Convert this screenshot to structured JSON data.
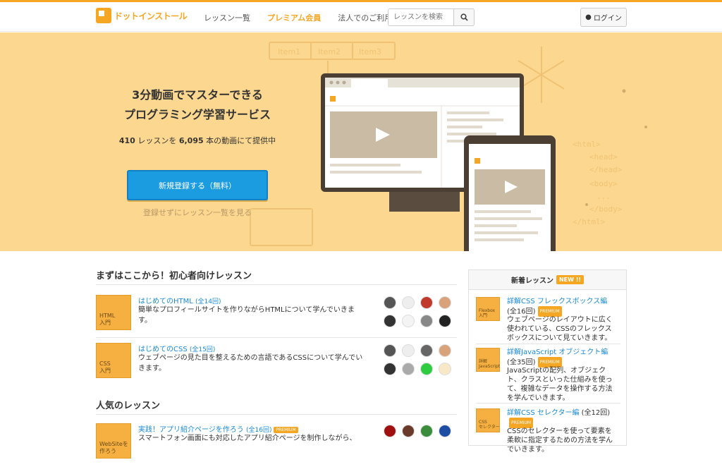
{
  "header": {
    "logo_text": "ドットインストール",
    "nav": [
      "レッスン一覧",
      "プレミアム会員",
      "法人でのご利用"
    ],
    "search_placeholder": "レッスンを検索",
    "login_label": "ログイン"
  },
  "hero": {
    "title_line1": "3分動画でマスターできる",
    "title_line2": "プログラミング学習サービス",
    "lessons_count": "410",
    "lessons_text1": " レッスンを ",
    "videos_count": "6,095",
    "lessons_text2": " 本の動画にて提供中",
    "cta_label": "新規登録する（無料）",
    "browse_link": "登録せずにレッスン一覧を見る",
    "art_tabs": [
      "Item1",
      "Item2",
      "Item3"
    ],
    "art_code": [
      "<html>",
      "<head>",
      "</head>",
      "<body>",
      "...",
      "</body>",
      "</html>"
    ]
  },
  "beginner": {
    "heading": "まずはここから！初心者向けレッスン",
    "lessons": [
      {
        "thumb": "HTML\n入門",
        "title": "はじめてのHTML",
        "count": "(全14回)",
        "desc": "簡単なプロフィールサイトを作りながらHTMLについて学んでいきます。"
      },
      {
        "thumb": "CSS\n入門",
        "title": "はじめてのCSS",
        "count": "(全15回)",
        "desc": "ウェブページの見た目を整えるための言語であるCSSについて学んでいきます。"
      }
    ]
  },
  "popular": {
    "heading": "人気のレッスン",
    "lessons": [
      {
        "thumb": "WebSiteを\n作ろう",
        "title": "実践！アプリ紹介ページを作ろう",
        "count": "(全16回)",
        "badge": "PREMIUM",
        "desc": "スマートフォン画面にも対応したアプリ紹介ページを制作しながら、"
      }
    ]
  },
  "sidebar": {
    "heading": "新着レッスン",
    "new_badge": "NEW !!",
    "items": [
      {
        "thumb": "Flexbox\n入門",
        "title": "詳解CSS フレックスボックス編",
        "count": "(全16回)",
        "badge": "PREMIUM",
        "desc": "ウェブページのレイアウトに広く使われている、CSSのフレックスボックスについて見ていきます。"
      },
      {
        "thumb": "詳解\nJavaScript",
        "title": "詳解JavaScript オブジェクト編",
        "count": "(全35回)",
        "badge": "PREMIUM",
        "desc": "JavaScriptの配列、オブジェクト、クラスといった仕組みを使って、複雑なデータを操作する方法を学んでいきます。"
      },
      {
        "thumb": "CSS\nセレクター",
        "title": "詳解CSS セレクター編",
        "count": "(全12回)",
        "badge": "PREMIUM",
        "desc": "CSSのセレクターを使って要素を柔軟に指定するための方法を学んでいきます。"
      }
    ]
  },
  "colors": {
    "accent": "#f5a623",
    "hero_bg": "#fcd78f",
    "link": "#1a8ad4",
    "cta": "#1b9be0"
  }
}
